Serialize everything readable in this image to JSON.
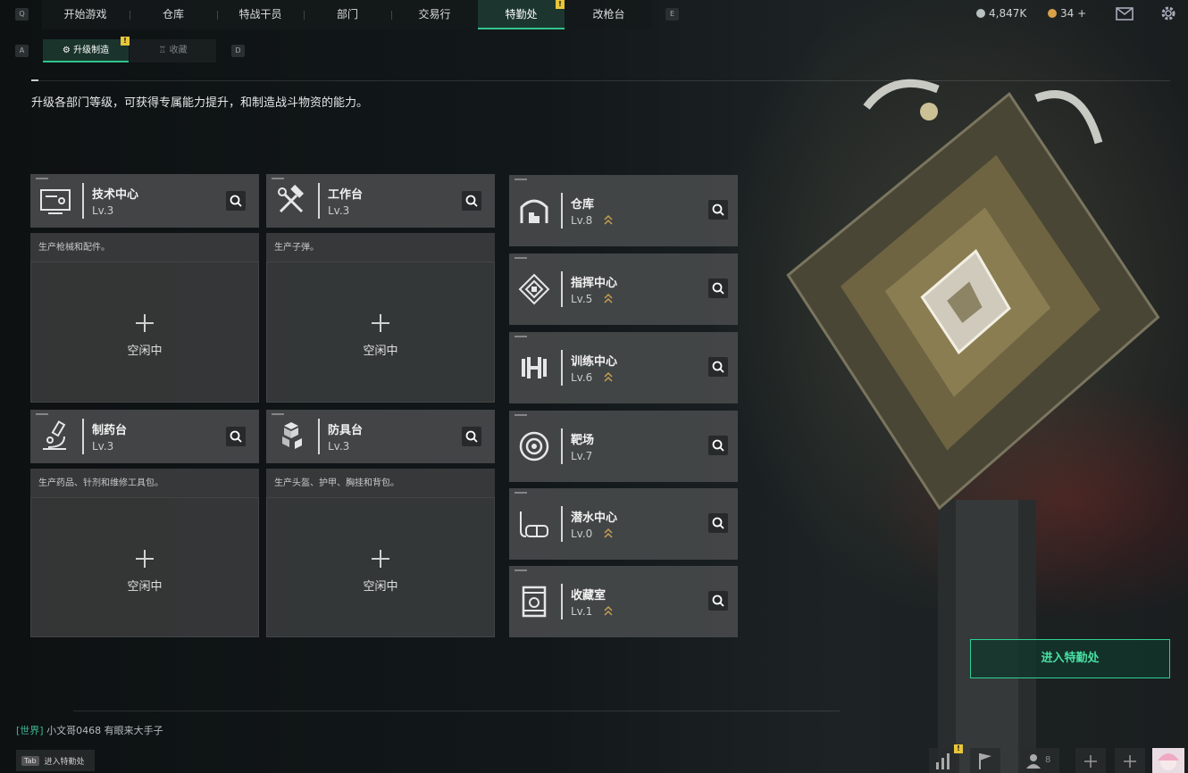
{
  "nav": {
    "left_key": "Q",
    "right_key": "E",
    "tabs": [
      {
        "label": "开始游戏"
      },
      {
        "label": "仓库"
      },
      {
        "label": "特战干员"
      },
      {
        "label": "部门"
      },
      {
        "label": "交易行"
      },
      {
        "label": "特勤处",
        "badge": "!"
      },
      {
        "label": "改枪台"
      }
    ],
    "currency": [
      {
        "value": "4,847K",
        "color": "#c0c6c6",
        "icon": "silver-coin-icon"
      },
      {
        "value": "34 +",
        "color": "#d9a14a",
        "icon": "gold-coin-icon"
      }
    ]
  },
  "subnav": {
    "left_key": "A",
    "right_key": "D",
    "tabs": [
      {
        "label": "升级制造",
        "badge": "!"
      },
      {
        "label": "收藏"
      }
    ]
  },
  "description": "升级各部门等级，可获得专属能力提升，和制造战斗物资的能力。",
  "production_cards": [
    {
      "name": "技术中心",
      "level": "Lv.3",
      "desc": "生产枪械和配件。",
      "status": "空闲中",
      "icon": "computer-icon"
    },
    {
      "name": "工作台",
      "level": "Lv.3",
      "desc": "生产子弹。",
      "status": "空闲中",
      "icon": "tools-icon"
    },
    {
      "name": "制药台",
      "level": "Lv.3",
      "desc": "生产药品、针剂和维修工具包。",
      "status": "空闲中",
      "icon": "microscope-icon"
    },
    {
      "name": "防具台",
      "level": "Lv.3",
      "desc": "生产头盔、护甲、胸挂和背包。",
      "status": "空闲中",
      "icon": "cubes-icon"
    }
  ],
  "departments": [
    {
      "name": "仓库",
      "level": "Lv.8",
      "icon": "warehouse-icon"
    },
    {
      "name": "指挥中心",
      "level": "Lv.5",
      "icon": "chip-icon"
    },
    {
      "name": "训练中心",
      "level": "Lv.6",
      "icon": "dumbbell-icon"
    },
    {
      "name": "靶场",
      "level": "Lv.7",
      "icon": "target-icon"
    },
    {
      "name": "潜水中心",
      "level": "Lv.0",
      "icon": "diving-mask-icon"
    },
    {
      "name": "收藏室",
      "level": "Lv.1",
      "icon": "display-case-icon"
    }
  ],
  "enter_button": "进入特勤处",
  "chat": {
    "channel": "[世界]",
    "user": "小文哥0468",
    "message": "有眼来大手子"
  },
  "tab_hint": {
    "key": "Tab",
    "label": "进入特勤处"
  },
  "bottom_bar": {
    "badge": "!",
    "friends_count": "8"
  },
  "colors": {
    "accent": "#31c48d",
    "badge": "#e8c63a",
    "upgrade": "#c8a050"
  }
}
